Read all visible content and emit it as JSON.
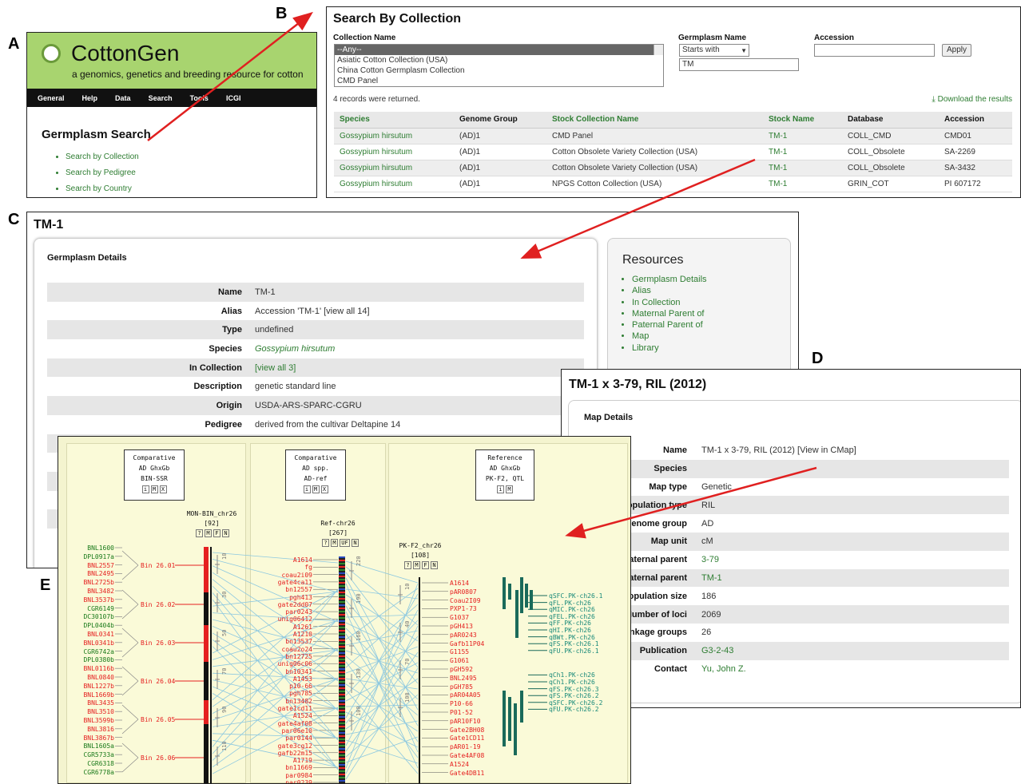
{
  "labels": {
    "a": "A",
    "b": "B",
    "c": "C",
    "d": "D",
    "e": "E"
  },
  "panel_a": {
    "title": "CottonGen",
    "subtitle": "a genomics, genetics and breeding resource for cotton",
    "nav": [
      "General",
      "Help",
      "Data",
      "Search",
      "Tools",
      "ICGI"
    ],
    "heading": "Germplasm Search",
    "links": [
      "Search by Collection",
      "Search by Pedigree",
      "Search by Country"
    ]
  },
  "panel_b": {
    "title": "Search By Collection",
    "collection_label": "Collection Name",
    "germplasm_label": "Germplasm Name",
    "accession_label": "Accession",
    "collections": [
      "--Any--",
      "Asiatic Cotton Collection (USA)",
      "China Cotton Germplasm Collection",
      "CMD Panel"
    ],
    "match": "Starts with",
    "germplasm_value": "TM",
    "accession_value": "",
    "apply": "Apply",
    "records": "4 records were returned.",
    "download": "Download the results",
    "headers": [
      "Species",
      "Genome Group",
      "Stock Collection Name",
      "Stock Name",
      "Database",
      "Accession"
    ],
    "rows": [
      [
        "Gossypium hirsutum",
        "(AD)1",
        "CMD Panel",
        "TM-1",
        "COLL_CMD",
        "CMD01"
      ],
      [
        "Gossypium hirsutum",
        "(AD)1",
        "Cotton Obsolete Variety Collection (USA)",
        "TM-1",
        "COLL_Obsolete",
        "SA-2269"
      ],
      [
        "Gossypium hirsutum",
        "(AD)1",
        "Cotton Obsolete Variety Collection (USA)",
        "TM-1",
        "COLL_Obsolete",
        "SA-3432"
      ],
      [
        "Gossypium hirsutum",
        "(AD)1",
        "NPGS Cotton Collection (USA)",
        "TM-1",
        "GRIN_COT",
        "PI 607172"
      ]
    ]
  },
  "panel_c": {
    "title": "TM-1",
    "section": "Germplasm Details",
    "details": [
      [
        "Name",
        "TM-1"
      ],
      [
        "Alias",
        "Accession 'TM-1' [view all 14]"
      ],
      [
        "Type",
        "undefined"
      ],
      [
        "Species",
        "Gossypium hirsutum"
      ],
      [
        "In Collection",
        "[view all 3]"
      ],
      [
        "Description",
        "genetic standard line"
      ],
      [
        "Origin",
        "USDA-ARS-SPARC-CGRU"
      ],
      [
        "Pedigree",
        "derived from the cultivar Deltapine 14"
      ]
    ],
    "resources_title": "Resources",
    "resources": [
      "Germplasm Details",
      "Alias",
      "In Collection",
      "Maternal Parent of",
      "Paternal Parent of",
      "Map",
      "Library"
    ]
  },
  "panel_d": {
    "title": "TM-1 x 3-79, RIL (2012)",
    "section": "Map Details",
    "details": [
      [
        "Name",
        "TM-1 x 3-79, RIL (2012) [View in CMap]"
      ],
      [
        "Species",
        ""
      ],
      [
        "Map type",
        "Genetic"
      ],
      [
        "Population type",
        "RIL"
      ],
      [
        "Genome group",
        "AD"
      ],
      [
        "Map unit",
        "cM"
      ],
      [
        "Paternal parent",
        "3-79"
      ],
      [
        "Maternal parent",
        "TM-1"
      ],
      [
        "Population size",
        "186"
      ],
      [
        "Number of loci",
        "2069"
      ],
      [
        "linkage groups",
        "26"
      ],
      [
        "Publication",
        "G3-2-43"
      ],
      [
        "Contact",
        "Yu, John Z."
      ]
    ]
  },
  "panel_e": {
    "map_titles": [
      [
        "Comparative",
        "AD GhxGb",
        "BIN-SSR"
      ],
      [
        "Comparative",
        "AD spp.",
        "AD-ref"
      ],
      [
        "Reference",
        "AD GhxGb",
        "PK-F2, QTL"
      ]
    ],
    "chr_names": [
      "MON-BIN_chr26",
      "[92]",
      "Ref-chr26",
      "[267]",
      "PK-F2_chr26",
      "[108]"
    ],
    "left_markers": [
      [
        "BNL1600",
        "g"
      ],
      [
        "DPL0917a",
        "g"
      ],
      [
        "BNL2557",
        "r"
      ],
      [
        "BNL2495",
        "r"
      ],
      [
        "BNL2725b",
        "r"
      ],
      [
        "BNL3482",
        "r"
      ],
      [
        "BNL3537b",
        "r"
      ],
      [
        "CGR6149",
        "g"
      ],
      [
        "DC30107b",
        "g"
      ],
      [
        "DPL0404b",
        "g"
      ],
      [
        "BNL0341",
        "r"
      ],
      [
        "BNL0341b",
        "r"
      ],
      [
        "CGR6742a",
        "g"
      ],
      [
        "DPL0380b",
        "g"
      ],
      [
        "BNL0116b",
        "r"
      ],
      [
        "BNL0840",
        "r"
      ],
      [
        "BNL1227b",
        "r"
      ],
      [
        "BNL1669b",
        "r"
      ],
      [
        "BNL3435",
        "r"
      ],
      [
        "BNL3510",
        "r"
      ],
      [
        "BNL3599b",
        "r"
      ],
      [
        "BNL3816",
        "r"
      ],
      [
        "BNL3867b",
        "r"
      ],
      [
        "BNL1605a",
        "g"
      ],
      [
        "CGR5733a",
        "g"
      ],
      [
        "CGR6318",
        "g"
      ],
      [
        "CGR6778a",
        "g"
      ]
    ],
    "bins": [
      "Bin 26.01",
      "Bin 26.02",
      "Bin 26.03",
      "Bin 26.04",
      "Bin 26.05",
      "Bin 26.06"
    ],
    "mid_markers": [
      "A1614",
      "fg",
      "coau2i09",
      "gate4ca11",
      "bn12557",
      "pgh413",
      "gate2dd07",
      "par0243",
      "unig06412",
      "A1261",
      "A1210",
      "bn13537",
      "coau2o24",
      "bn12725",
      "unig06c06",
      "bn10341",
      "A1453",
      "p10-66",
      "pgh785",
      "bn13482",
      "gate1cd11",
      "A1524",
      "gate4af08",
      "par06e10",
      "par0144",
      "gate3cg12",
      "gafb22m15",
      "A1719",
      "bn11669",
      "par0984",
      "par0239"
    ],
    "right_markers": [
      "A1614",
      "pAR0807",
      "Coau2I09",
      "PXP1-73",
      "G1037",
      "pGH413",
      "pAR0243",
      "Gafb11P04",
      "G1155",
      "G1061",
      "pGH592",
      "BNL2495",
      "pGH785",
      "pAR04A05",
      "P10-66",
      "P01-52",
      "pAR10F10",
      "Gate2BH08",
      "Gate1CD11",
      "pAR01-19",
      "Gate4AF08",
      "A1524",
      "Gate4DB11"
    ],
    "qtls": [
      "qSFC.PK-ch26.1",
      "qFL.PK-ch26",
      "qMIC.PK-ch26",
      "qFEL.PK-ch26",
      "qFF.PK-ch26",
      "qHI.PK-ch26",
      "qBWt.PK-ch26",
      "qFS.PK-ch26.1",
      "qFU.PK-ch26.1",
      "qCh1.PK-ch26",
      "qCh1.PK-ch26",
      "qFS.PK-ch26.3",
      "qFS.PK-ch26.2",
      "qSFC.PK-ch26.2",
      "qFU.PK-ch26.2"
    ],
    "scales": [
      "10",
      "30",
      "50",
      "70",
      "90",
      "110",
      "220",
      "190",
      "160",
      "130",
      "100",
      "10",
      "40",
      "70",
      "100"
    ],
    "buttons1": [
      "?",
      "M",
      "F",
      "N"
    ],
    "buttons2": [
      "?",
      "M",
      "UF",
      "N"
    ],
    "buttons3": [
      "?",
      "M",
      "F",
      "N"
    ],
    "tb1": [
      "i",
      "M",
      "X"
    ],
    "tb2": [
      "i",
      "M",
      "X"
    ],
    "tb3": [
      "i",
      "M"
    ]
  }
}
